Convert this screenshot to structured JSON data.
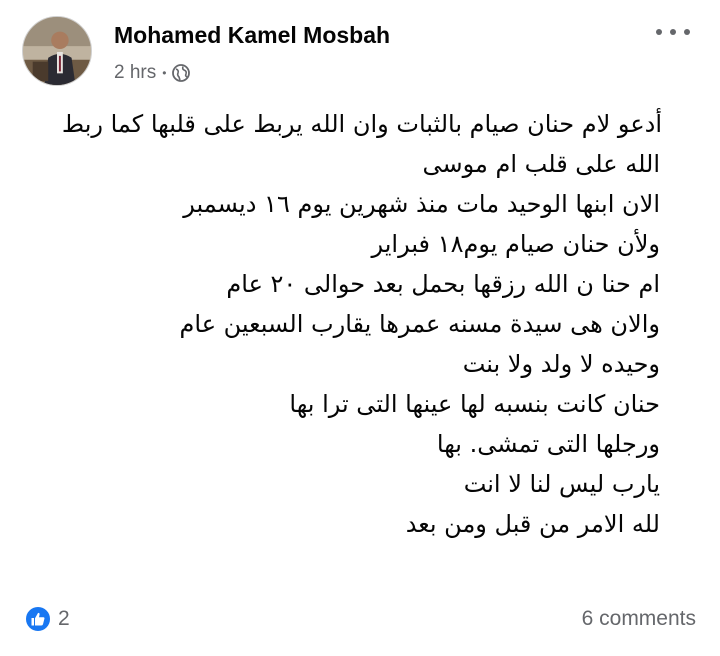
{
  "post": {
    "author": "Mohamed Kamel Mosbah",
    "time": "2 hrs",
    "separator": "•",
    "privacy_icon": "globe-icon",
    "more_icon": "more-options-icon",
    "lines": [
      "أدعو لام حنان صيام بالثبات وان الله يربط على قلبها كما ربط",
      "الله على قلب ام موسى",
      "الان ابنها الوحيد مات منذ شهرين يوم ١٦ ديسمبر",
      "ولأن حنان صيام يوم١٨ فبراير",
      "ام حنا ن الله رزقها بحمل بعد حوالى ٢٠ عام",
      "والان هى سيدة مسنه عمرها يقارب السبعين عام",
      "وحيده لا ولد ولا بنت",
      "حنان كانت بنسبه لها عينها  التى ترا بها",
      "ورجلها التى تمشى. بها",
      "يارب ليس لنا لا انت",
      "لله الامر من قبل ومن بعد"
    ],
    "reactions": {
      "icon": "like-icon",
      "count": "2",
      "color": "#1877f2"
    },
    "comments_label": "6 comments"
  }
}
